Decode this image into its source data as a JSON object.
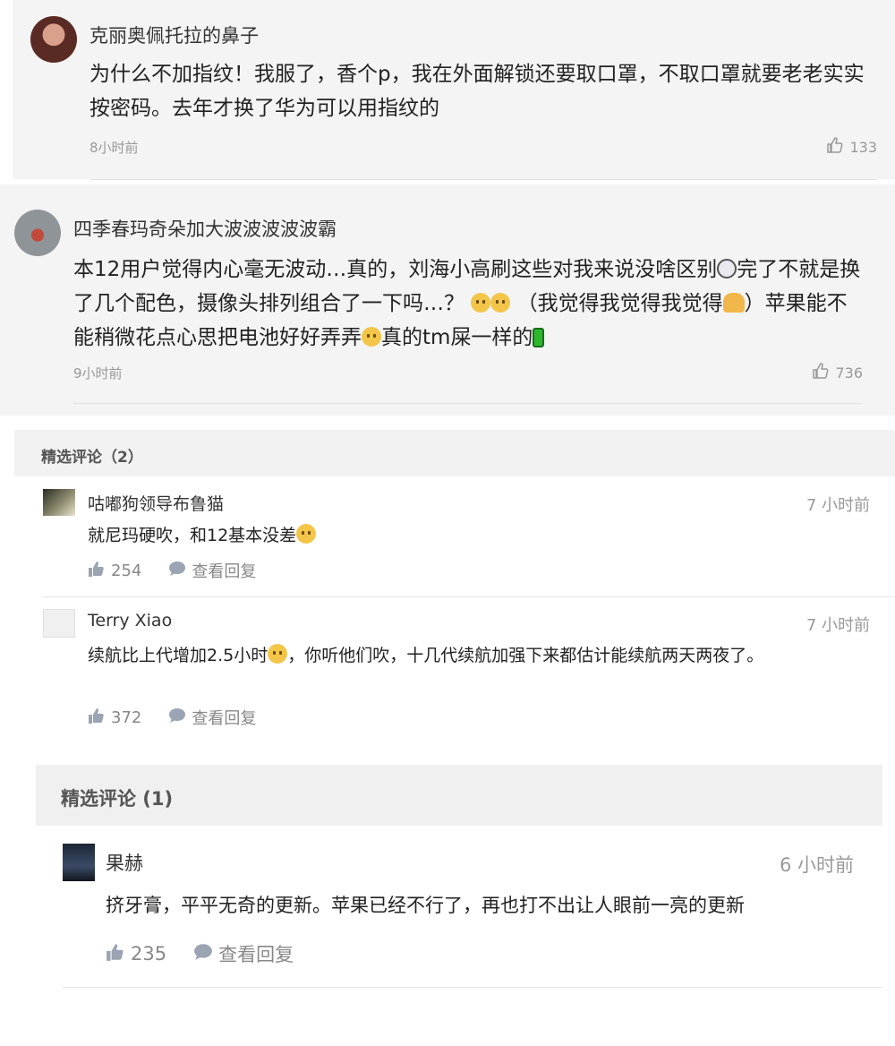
{
  "comments_top": [
    {
      "username": "克丽奥佩托拉的鼻子",
      "text": "为什么不加指纹！我服了，香个p，我在外面解锁还要取口罩，不取口罩就要老老实实按密码。去年才换了华为可以用指纹的",
      "time": "8小时前",
      "likes": "133"
    },
    {
      "username": "四季春玛奇朵加大波波波波波霸",
      "text_parts": [
        "本12用户觉得内心毫无波动…真的，刘海小高刷这些对我来说没啥区别",
        "完了不就是换了几个配色，摄像头排列组合了一下吗…？",
        "（我觉得我觉得我觉得",
        "）苹果能不能稍微花点心思把电池好好弄弄",
        "真的tm屎一样的"
      ],
      "time": "9小时前",
      "likes": "736"
    }
  ],
  "featured_a": {
    "title": "精选评论（2）",
    "comments": [
      {
        "username": "咕嘟狗领导布鲁猫",
        "time": "7 小时前",
        "text": "就尼玛硬吹，和12基本没差",
        "likes": "254",
        "reply_label": "查看回复"
      },
      {
        "username": "Terry Xiao",
        "time": "7 小时前",
        "text_parts": [
          "续航比上代增加2.5小时",
          "，你听他们吹，十几代续航加强下来都估计能续航两天两夜了。"
        ],
        "likes": "372",
        "reply_label": "查看回复"
      }
    ]
  },
  "featured_b": {
    "title": "精选评论 (1)",
    "comments": [
      {
        "username": "果赫",
        "time": "6 小时前",
        "text": "挤牙膏，平平无奇的更新。苹果已经不行了，再也打不出让人眼前一亮的更新",
        "likes": "235",
        "reply_label": "查看回复"
      }
    ]
  },
  "icons": {
    "like_outline": "thumbs-up-outline-icon",
    "like_filled": "thumbs-up-filled-icon",
    "reply": "speech-bubble-icon"
  },
  "colors": {
    "card_bg": "#f4f4f4",
    "muted": "#999999"
  }
}
